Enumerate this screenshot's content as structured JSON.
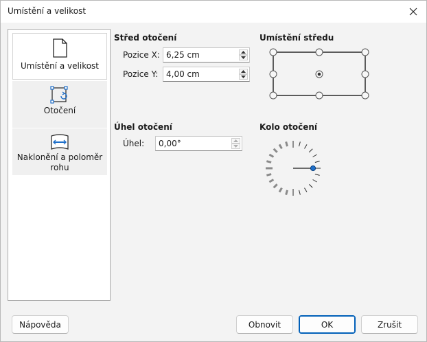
{
  "window": {
    "title": "Umístění a velikost"
  },
  "sidebar": {
    "items": [
      {
        "label": "Umístění a velikost",
        "icon": "page-icon",
        "active": true
      },
      {
        "label": "Otočení",
        "icon": "rotation-icon",
        "active": false
      },
      {
        "label": "Naklonění a poloměr rohu",
        "icon": "slant-icon",
        "active": false
      }
    ]
  },
  "pivot": {
    "title": "Střed otočení",
    "x_label": "Pozice X:",
    "x_value": "6,25 cm",
    "y_label": "Pozice Y:",
    "y_value": "4,00 cm"
  },
  "center_placement": {
    "title": "Umístění středu"
  },
  "angle": {
    "title": "Úhel otočení",
    "label": "Úhel:",
    "value": "0,00°"
  },
  "wheel": {
    "title": "Kolo otočení"
  },
  "buttons": {
    "help": "Nápověda",
    "reset": "Obnovit",
    "ok": "OK",
    "cancel": "Zrušit"
  },
  "colors": {
    "accent": "#005fb8",
    "icon_blue": "#1f6fc9"
  }
}
